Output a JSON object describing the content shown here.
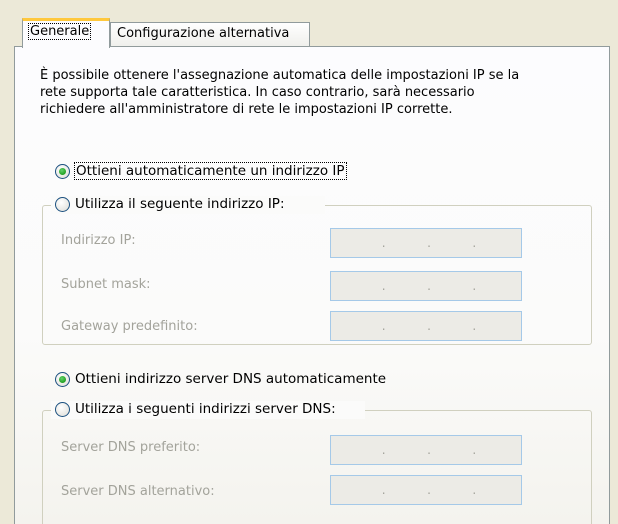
{
  "tabs": [
    {
      "label": "Generale",
      "active": true
    },
    {
      "label": "Configurazione alternativa",
      "active": false
    }
  ],
  "description": [
    "È possibile ottenere l'assegnazione automatica delle impostazioni IP se la",
    "rete supporta tale caratteristica. In caso contrario, sarà necessario",
    "richiedere all'amministratore di rete le impostazioni IP corrette."
  ],
  "ip_section": {
    "auto_option": {
      "label": "Ottieni automaticamente un indirizzo IP",
      "checked": true
    },
    "manual_option": {
      "label": "Utilizza il seguente indirizzo IP:",
      "checked": false
    },
    "fields": [
      {
        "label": "Indirizzo IP:",
        "value": "   .   .   .   "
      },
      {
        "label": "Subnet mask:",
        "value": "   .   .   .   "
      },
      {
        "label": "Gateway predefinito:",
        "value": "   .   .   .   "
      }
    ]
  },
  "dns_section": {
    "auto_option": {
      "label": "Ottieni indirizzo server DNS automaticamente",
      "checked": true
    },
    "manual_option": {
      "label": "Utilizza i seguenti indirizzi server DNS:",
      "checked": false
    },
    "fields": [
      {
        "label": "Server DNS preferito:",
        "value": "   .   .   .   "
      },
      {
        "label": "Server DNS alternativo:",
        "value": "   .   .   .   "
      }
    ]
  },
  "colors": {
    "tab_highlight": "#ffc83c",
    "radio_dot": "#21a121",
    "disabled_text": "#a3a39b",
    "group_border": "#d0d0bf"
  }
}
